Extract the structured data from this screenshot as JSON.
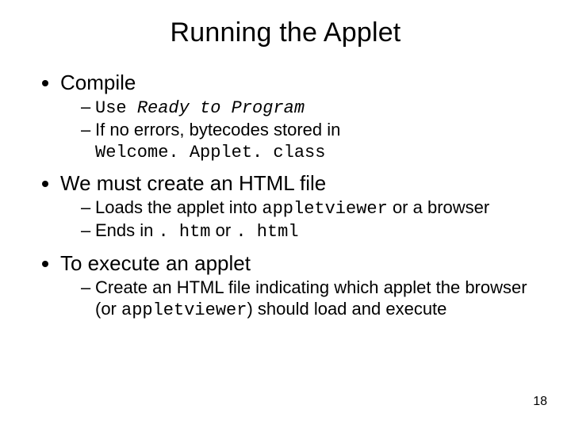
{
  "title": "Running the Applet",
  "bullets": {
    "b1": "Compile",
    "b1s1_pre": "Use ",
    "b1s1_mono": "Ready to Program",
    "b1s2_a": "If no errors, bytecodes stored in ",
    "b1s2_b": "Welcome. Applet. class",
    "b2": "We must create an HTML file",
    "b2s1_a": "Loads the applet into ",
    "b2s1_b": "appletviewer",
    "b2s1_c": " or a browser",
    "b2s2_a": "Ends in ",
    "b2s2_b": ". htm",
    "b2s2_c": " or ",
    "b2s2_d": ". html",
    "b3": "To execute an applet",
    "b3s1_a": "Create an HTML file indicating which applet the browser (or ",
    "b3s1_b": "appletviewer",
    "b3s1_c": ") should load and execute"
  },
  "page": "18"
}
